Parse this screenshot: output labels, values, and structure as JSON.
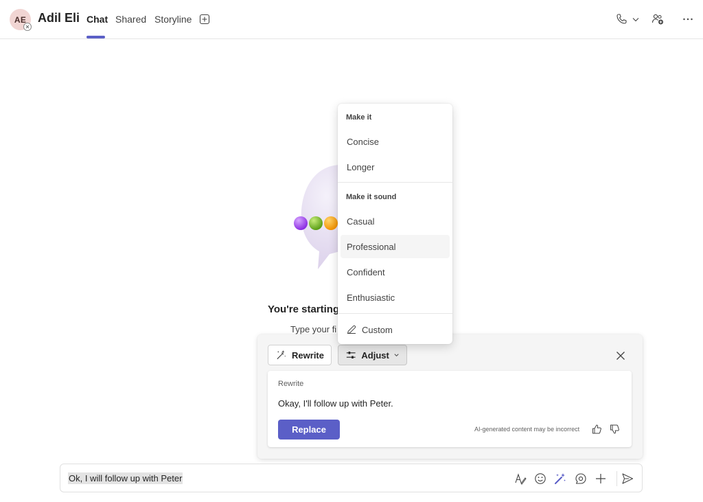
{
  "header": {
    "avatar_initials": "AE",
    "contact_name": "Adil Eli",
    "tabs": [
      {
        "label": "Chat",
        "active": true
      },
      {
        "label": "Shared",
        "active": false
      },
      {
        "label": "Storyline",
        "active": false
      }
    ],
    "icons": [
      "add-tab-icon",
      "phone-icon",
      "chevron-down-icon",
      "people-add-icon",
      "more-icon"
    ],
    "accent_color": "#5b5fc7"
  },
  "welcome": {
    "title": "You're starting",
    "subtitle": "Type your fi"
  },
  "adjust_menu": {
    "section1_header": "Make it",
    "section1_items": [
      "Concise",
      "Longer"
    ],
    "section2_header": "Make it sound",
    "section2_items": [
      "Casual",
      "Professional",
      "Confident",
      "Enthusiastic"
    ],
    "hovered_item": "Professional",
    "custom_label": "Custom"
  },
  "rewrite_panel": {
    "rewrite_button": "Rewrite",
    "adjust_button": "Adjust",
    "card_label": "Rewrite",
    "card_text": "Okay, I'll follow up with Peter.",
    "replace_button": "Replace",
    "disclaimer": "AI-generated content may be incorrect"
  },
  "compose": {
    "text": "Ok, I will follow up with Peter",
    "icons": [
      "format-icon",
      "emoji-icon",
      "copilot-rewrite-icon",
      "loop-icon",
      "plus-icon",
      "send-icon"
    ]
  }
}
